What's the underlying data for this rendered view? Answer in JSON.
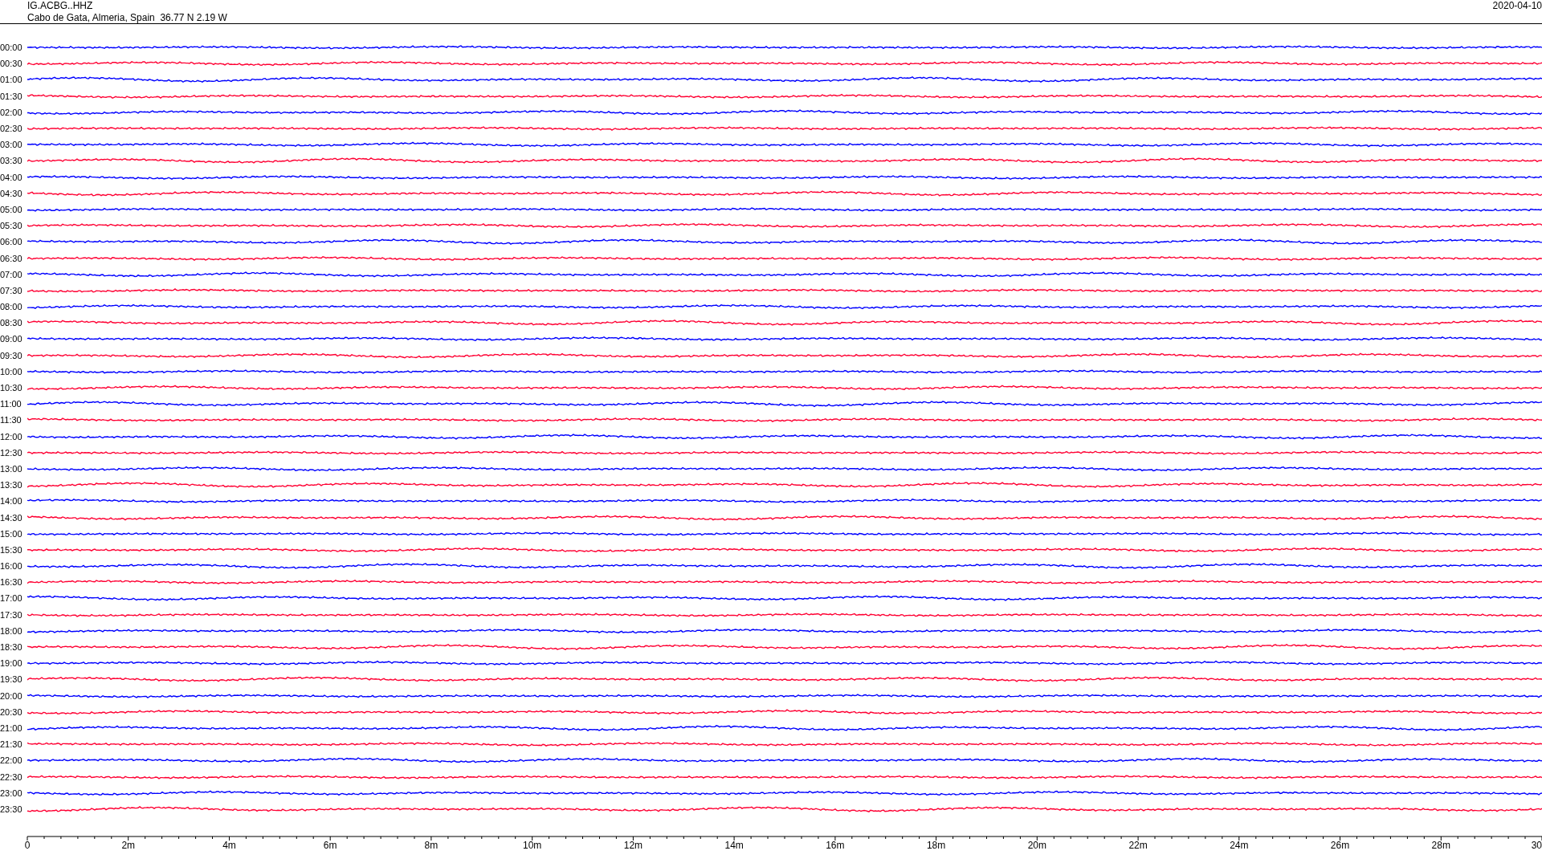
{
  "header": {
    "station": "IG.ACBG..HHZ",
    "location": "Cabo de Gata, Almeria, Spain  36.77 N 2.19 W",
    "date": "2020-04-10"
  },
  "traces": [
    {
      "label": "00:00",
      "color": "#0000ff"
    },
    {
      "label": "00:30",
      "color": "#ff0033"
    },
    {
      "label": "01:00",
      "color": "#0000ff"
    },
    {
      "label": "01:30",
      "color": "#ff0033"
    },
    {
      "label": "02:00",
      "color": "#0000ff"
    },
    {
      "label": "02:30",
      "color": "#ff0033"
    },
    {
      "label": "03:00",
      "color": "#0000ff"
    },
    {
      "label": "03:30",
      "color": "#ff0033"
    },
    {
      "label": "04:00",
      "color": "#0000ff"
    },
    {
      "label": "04:30",
      "color": "#ff0033"
    },
    {
      "label": "05:00",
      "color": "#0000ff"
    },
    {
      "label": "05:30",
      "color": "#ff0033"
    },
    {
      "label": "06:00",
      "color": "#0000ff"
    },
    {
      "label": "06:30",
      "color": "#ff0033"
    },
    {
      "label": "07:00",
      "color": "#0000ff"
    },
    {
      "label": "07:30",
      "color": "#ff0033"
    },
    {
      "label": "08:00",
      "color": "#0000ff"
    },
    {
      "label": "08:30",
      "color": "#ff0033"
    },
    {
      "label": "09:00",
      "color": "#0000ff"
    },
    {
      "label": "09:30",
      "color": "#ff0033"
    },
    {
      "label": "10:00",
      "color": "#0000ff"
    },
    {
      "label": "10:30",
      "color": "#ff0033"
    },
    {
      "label": "11:00",
      "color": "#0000ff"
    },
    {
      "label": "11:30",
      "color": "#ff0033"
    },
    {
      "label": "12:00",
      "color": "#0000ff"
    },
    {
      "label": "12:30",
      "color": "#ff0033"
    },
    {
      "label": "13:00",
      "color": "#0000ff"
    },
    {
      "label": "13:30",
      "color": "#ff0033"
    },
    {
      "label": "14:00",
      "color": "#0000ff"
    },
    {
      "label": "14:30",
      "color": "#ff0033"
    },
    {
      "label": "15:00",
      "color": "#0000ff"
    },
    {
      "label": "15:30",
      "color": "#ff0033"
    },
    {
      "label": "16:00",
      "color": "#0000ff"
    },
    {
      "label": "16:30",
      "color": "#ff0033"
    },
    {
      "label": "17:00",
      "color": "#0000ff"
    },
    {
      "label": "17:30",
      "color": "#ff0033"
    },
    {
      "label": "18:00",
      "color": "#0000ff"
    },
    {
      "label": "18:30",
      "color": "#ff0033"
    },
    {
      "label": "19:00",
      "color": "#0000ff"
    },
    {
      "label": "19:30",
      "color": "#ff0033"
    },
    {
      "label": "20:00",
      "color": "#0000ff"
    },
    {
      "label": "20:30",
      "color": "#ff0033"
    },
    {
      "label": "21:00",
      "color": "#0000ff"
    },
    {
      "label": "21:30",
      "color": "#ff0033"
    },
    {
      "label": "22:00",
      "color": "#0000ff"
    },
    {
      "label": "22:30",
      "color": "#ff0033"
    },
    {
      "label": "23:00",
      "color": "#0000ff"
    },
    {
      "label": "23:30",
      "color": "#ff0033"
    }
  ],
  "x_axis": {
    "labels": [
      "0",
      "2m",
      "4m",
      "6m",
      "8m",
      "10m",
      "12m",
      "14m",
      "16m",
      "18m",
      "20m",
      "22m",
      "24m",
      "26m",
      "28m",
      "30"
    ]
  }
}
